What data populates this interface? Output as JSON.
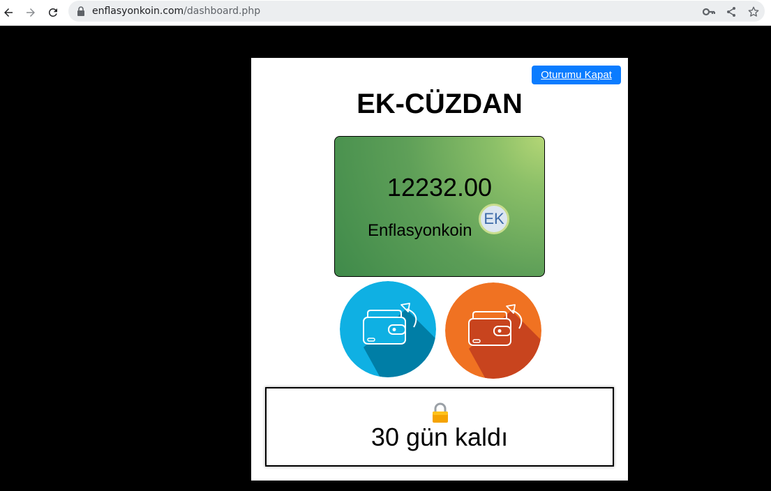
{
  "browser": {
    "url_host": "enflasyonkoin.com",
    "url_path": "/dashboard.php",
    "icons": [
      "back-icon",
      "forward-icon",
      "reload-icon",
      "lock-icon",
      "key-icon",
      "share-icon",
      "star-icon"
    ]
  },
  "page": {
    "logout_label": "Oturumu Kapat",
    "title": "EK-CÜZDAN",
    "card": {
      "balance": "12232.00",
      "coin_name": "Enflasyonkoin",
      "coin_badge": "EK",
      "colors": {
        "light": "#b4d676",
        "dark": "#3f8a4a"
      }
    },
    "actions": [
      {
        "name": "receive-wallet-button",
        "color": "#0fb0e3"
      },
      {
        "name": "send-wallet-button",
        "color": "#f07222"
      }
    ],
    "lock": {
      "icon": "lock-icon",
      "days_left": "30 gün kaldı"
    },
    "accent_color": "#0a7cff"
  }
}
